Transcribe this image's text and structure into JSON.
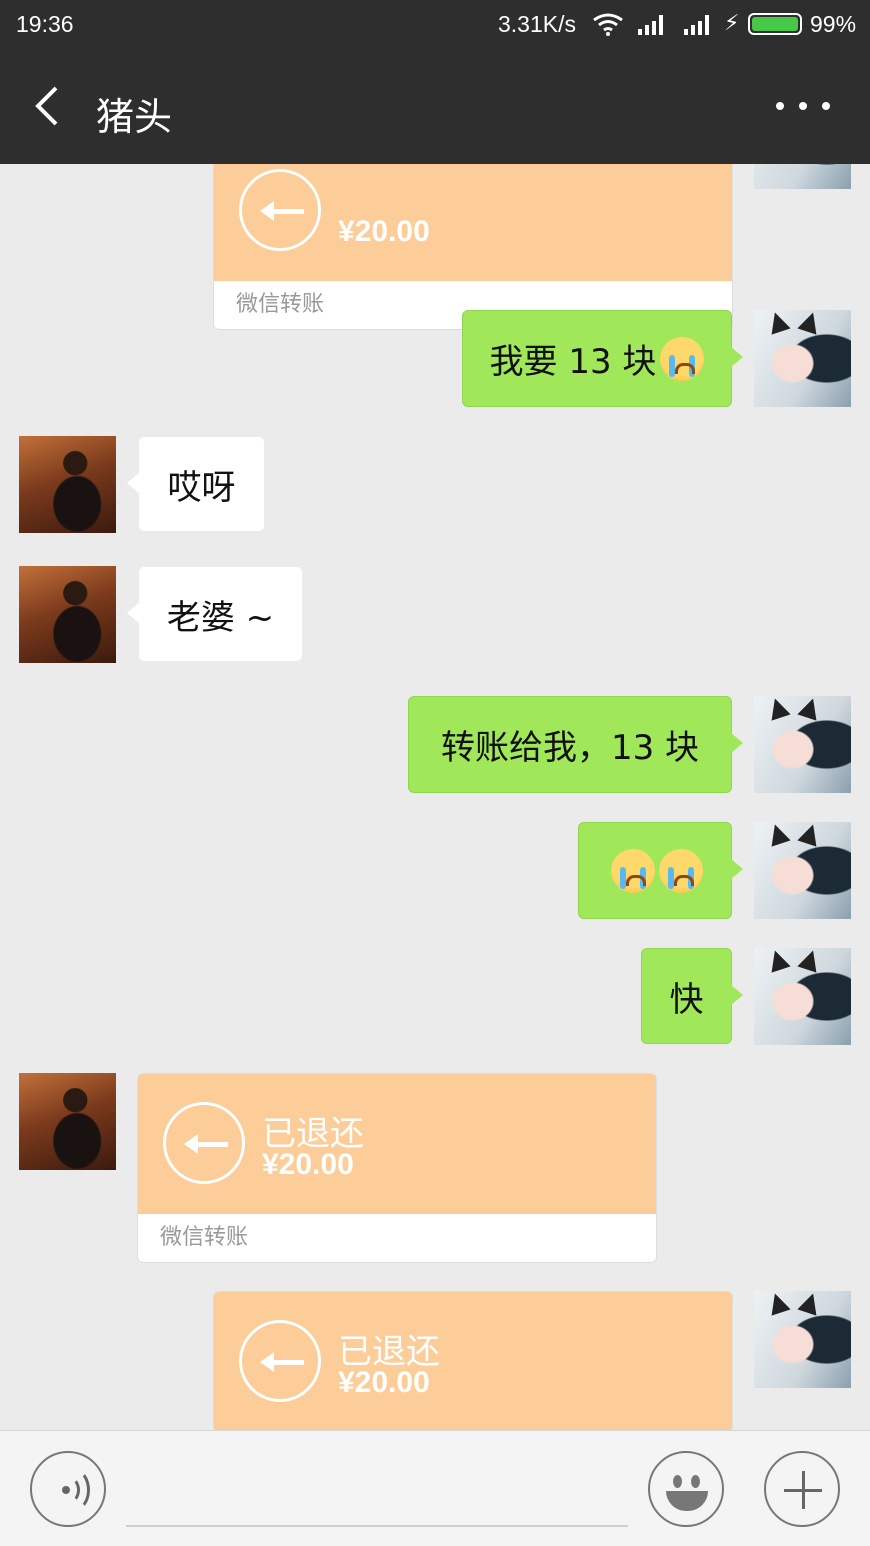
{
  "status_bar": {
    "time": "19:36",
    "net_speed": "3.31K/s",
    "battery_percent": "99%",
    "battery_level": 0.99,
    "icons": [
      "wifi-icon",
      "signal-icon",
      "signal-icon",
      "charging-icon",
      "battery-icon"
    ]
  },
  "header": {
    "back_icon": "chevron-left-icon",
    "title": "猪头",
    "more_icon": "more-dots-icon"
  },
  "messages": [
    {
      "type": "transfer",
      "side": "mine",
      "status": "",
      "amount": "¥20.00",
      "footer": "微信转账"
    },
    {
      "type": "text",
      "side": "mine",
      "text": "我要 13 块",
      "emoji": "crying-emoji"
    },
    {
      "type": "text",
      "side": "theirs",
      "text": "哎呀"
    },
    {
      "type": "text",
      "side": "theirs",
      "text": "老婆 ~"
    },
    {
      "type": "text",
      "side": "mine",
      "text": "转账给我，13 块"
    },
    {
      "type": "emoji",
      "side": "mine",
      "emoji": [
        "crying-emoji",
        "crying-emoji"
      ]
    },
    {
      "type": "text",
      "side": "mine",
      "text": "快"
    },
    {
      "type": "transfer",
      "side": "theirs",
      "status": "已退还",
      "amount": "¥20.00",
      "footer": "微信转账"
    },
    {
      "type": "transfer",
      "side": "mine",
      "status": "已退还",
      "amount": "¥20.00",
      "footer": ""
    }
  ],
  "input_bar": {
    "voice_icon": "voice-icon",
    "emoji_icon": "smile-icon",
    "plus_icon": "plus-icon"
  },
  "colors": {
    "header_bg": "#2e2e2e",
    "chat_bg": "#ebebeb",
    "mine_bubble": "#a0e75a",
    "theirs_bubble": "#ffffff",
    "transfer_bg": "#fccd98"
  }
}
